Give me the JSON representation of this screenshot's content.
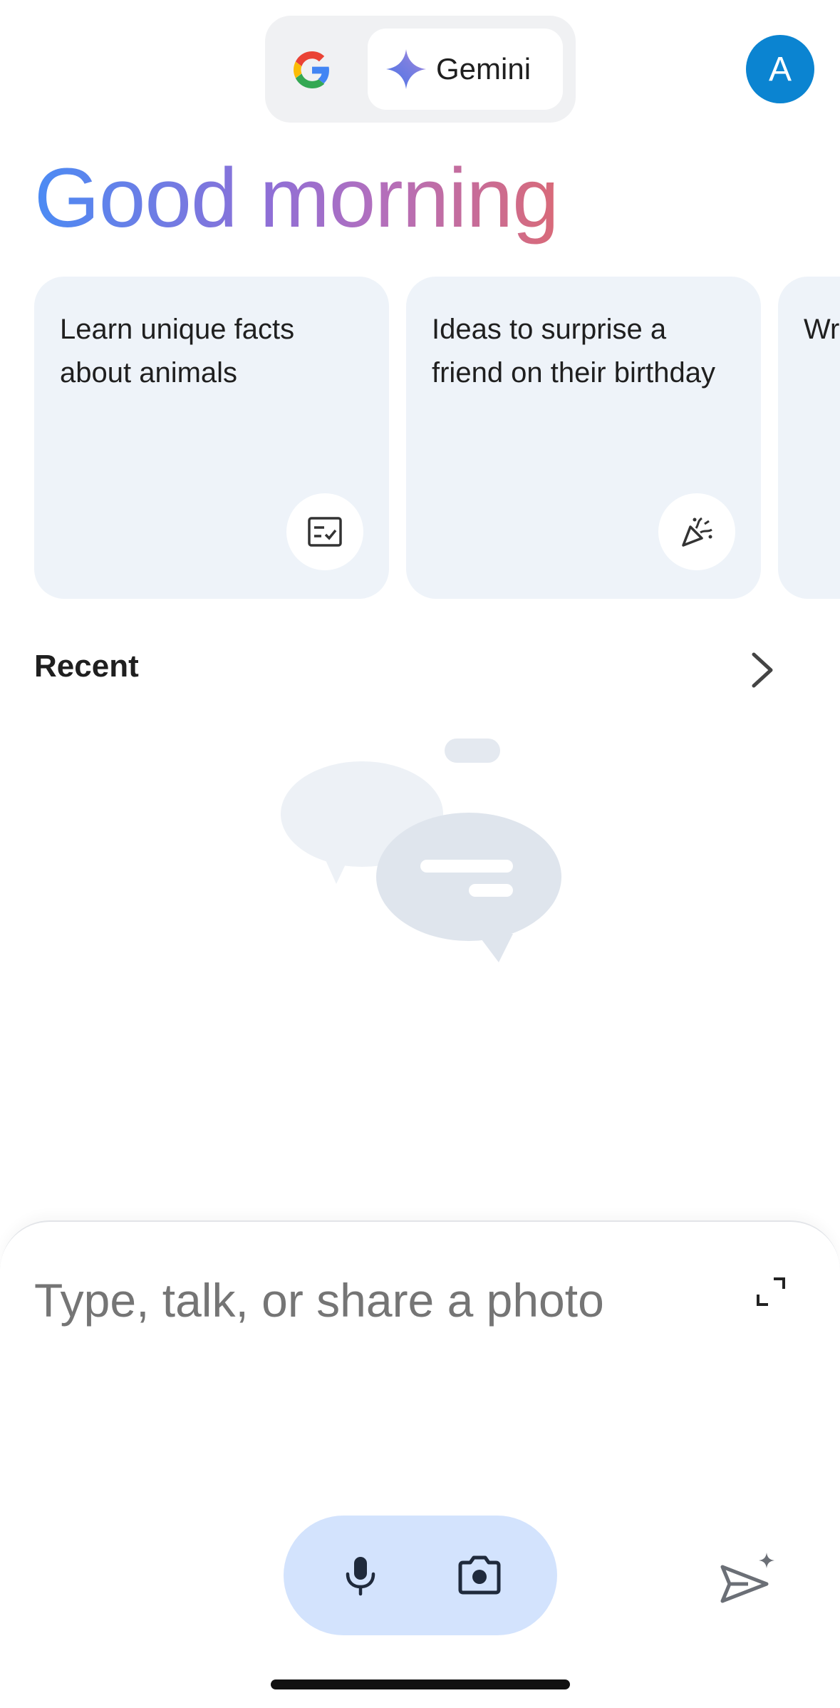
{
  "switcher": {
    "google_icon": "google-g-icon",
    "gemini_label": "Gemini",
    "gemini_icon": "gemini-sparkle-icon"
  },
  "avatar": {
    "initial": "A",
    "color": "#0b84d1"
  },
  "greeting": "Good morning",
  "cards": [
    {
      "text": "Learn unique facts about animals",
      "icon": "checklist-icon"
    },
    {
      "text": "Ideas to surprise a friend on their birthday",
      "icon": "party-popper-icon"
    },
    {
      "text": "Wr no",
      "icon": ""
    }
  ],
  "recent": {
    "title": "Recent",
    "icon": "chevron-right-icon"
  },
  "input": {
    "placeholder": "Type, talk, or share a photo",
    "expand_icon": "expand-icon",
    "mic_icon": "microphone-icon",
    "camera_icon": "camera-icon",
    "send_icon": "send-sparkle-icon"
  },
  "colors": {
    "card_bg": "#eef3f9",
    "pill_bg": "#d3e3fd",
    "greeting_gradient": [
      "#4b8bf4",
      "#8f6fd6",
      "#d96a78"
    ]
  }
}
